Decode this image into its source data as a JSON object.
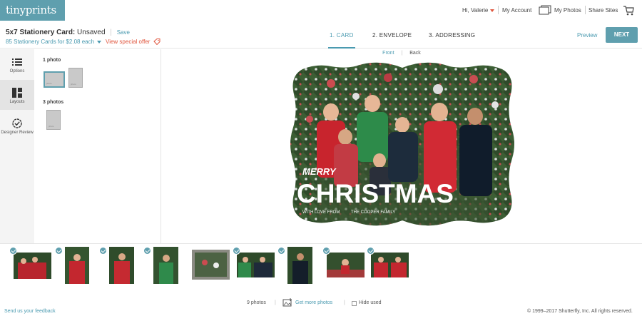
{
  "brand": {
    "logo_text": "tinyprints",
    "accent": "#5f9fae",
    "link": "#4a9ab0",
    "offer": "#e0553d"
  },
  "topnav": {
    "greeting": "Hi, Valerie",
    "my_account": "My Account",
    "my_photos": "My Photos",
    "share_sites": "Share Sites"
  },
  "header": {
    "title_bold": "5x7 Stationery Card:",
    "title_status": " Unsaved",
    "save": "Save",
    "price": "85 Stationery Cards for $2.08 each",
    "offer": "View special offer",
    "steps": [
      {
        "label": "1.  CARD"
      },
      {
        "label": "2.  ENVELOPE"
      },
      {
        "label": "3.  ADDRESSING"
      }
    ],
    "preview": "Preview",
    "next": "NEXT"
  },
  "sidebar": {
    "items": [
      {
        "label": "Options",
        "icon": "list-icon"
      },
      {
        "label": "Layouts",
        "icon": "layouts-icon"
      },
      {
        "label": "Designer Review",
        "icon": "check-circle-icon"
      }
    ]
  },
  "layouts": {
    "section1": "1 photo",
    "section2": "3 photos",
    "thumb_label": "photo"
  },
  "canvas": {
    "front": "Front",
    "back": "Back",
    "card_text_merry": "MERRY",
    "card_text_christmas": "CHRISTMAS",
    "card_text_love": "WITH LOVE FROM",
    "card_text_family": "THE COOPER FAMILY"
  },
  "photos": {
    "count": 9
  },
  "footer": {
    "feedback": "Send us your feedback",
    "photo_count": "9 photos",
    "get_more": "Get more photos",
    "hide_used": "Hide used",
    "copyright": "© 1999–2017 Shutterfly, Inc. All rights reserved."
  }
}
